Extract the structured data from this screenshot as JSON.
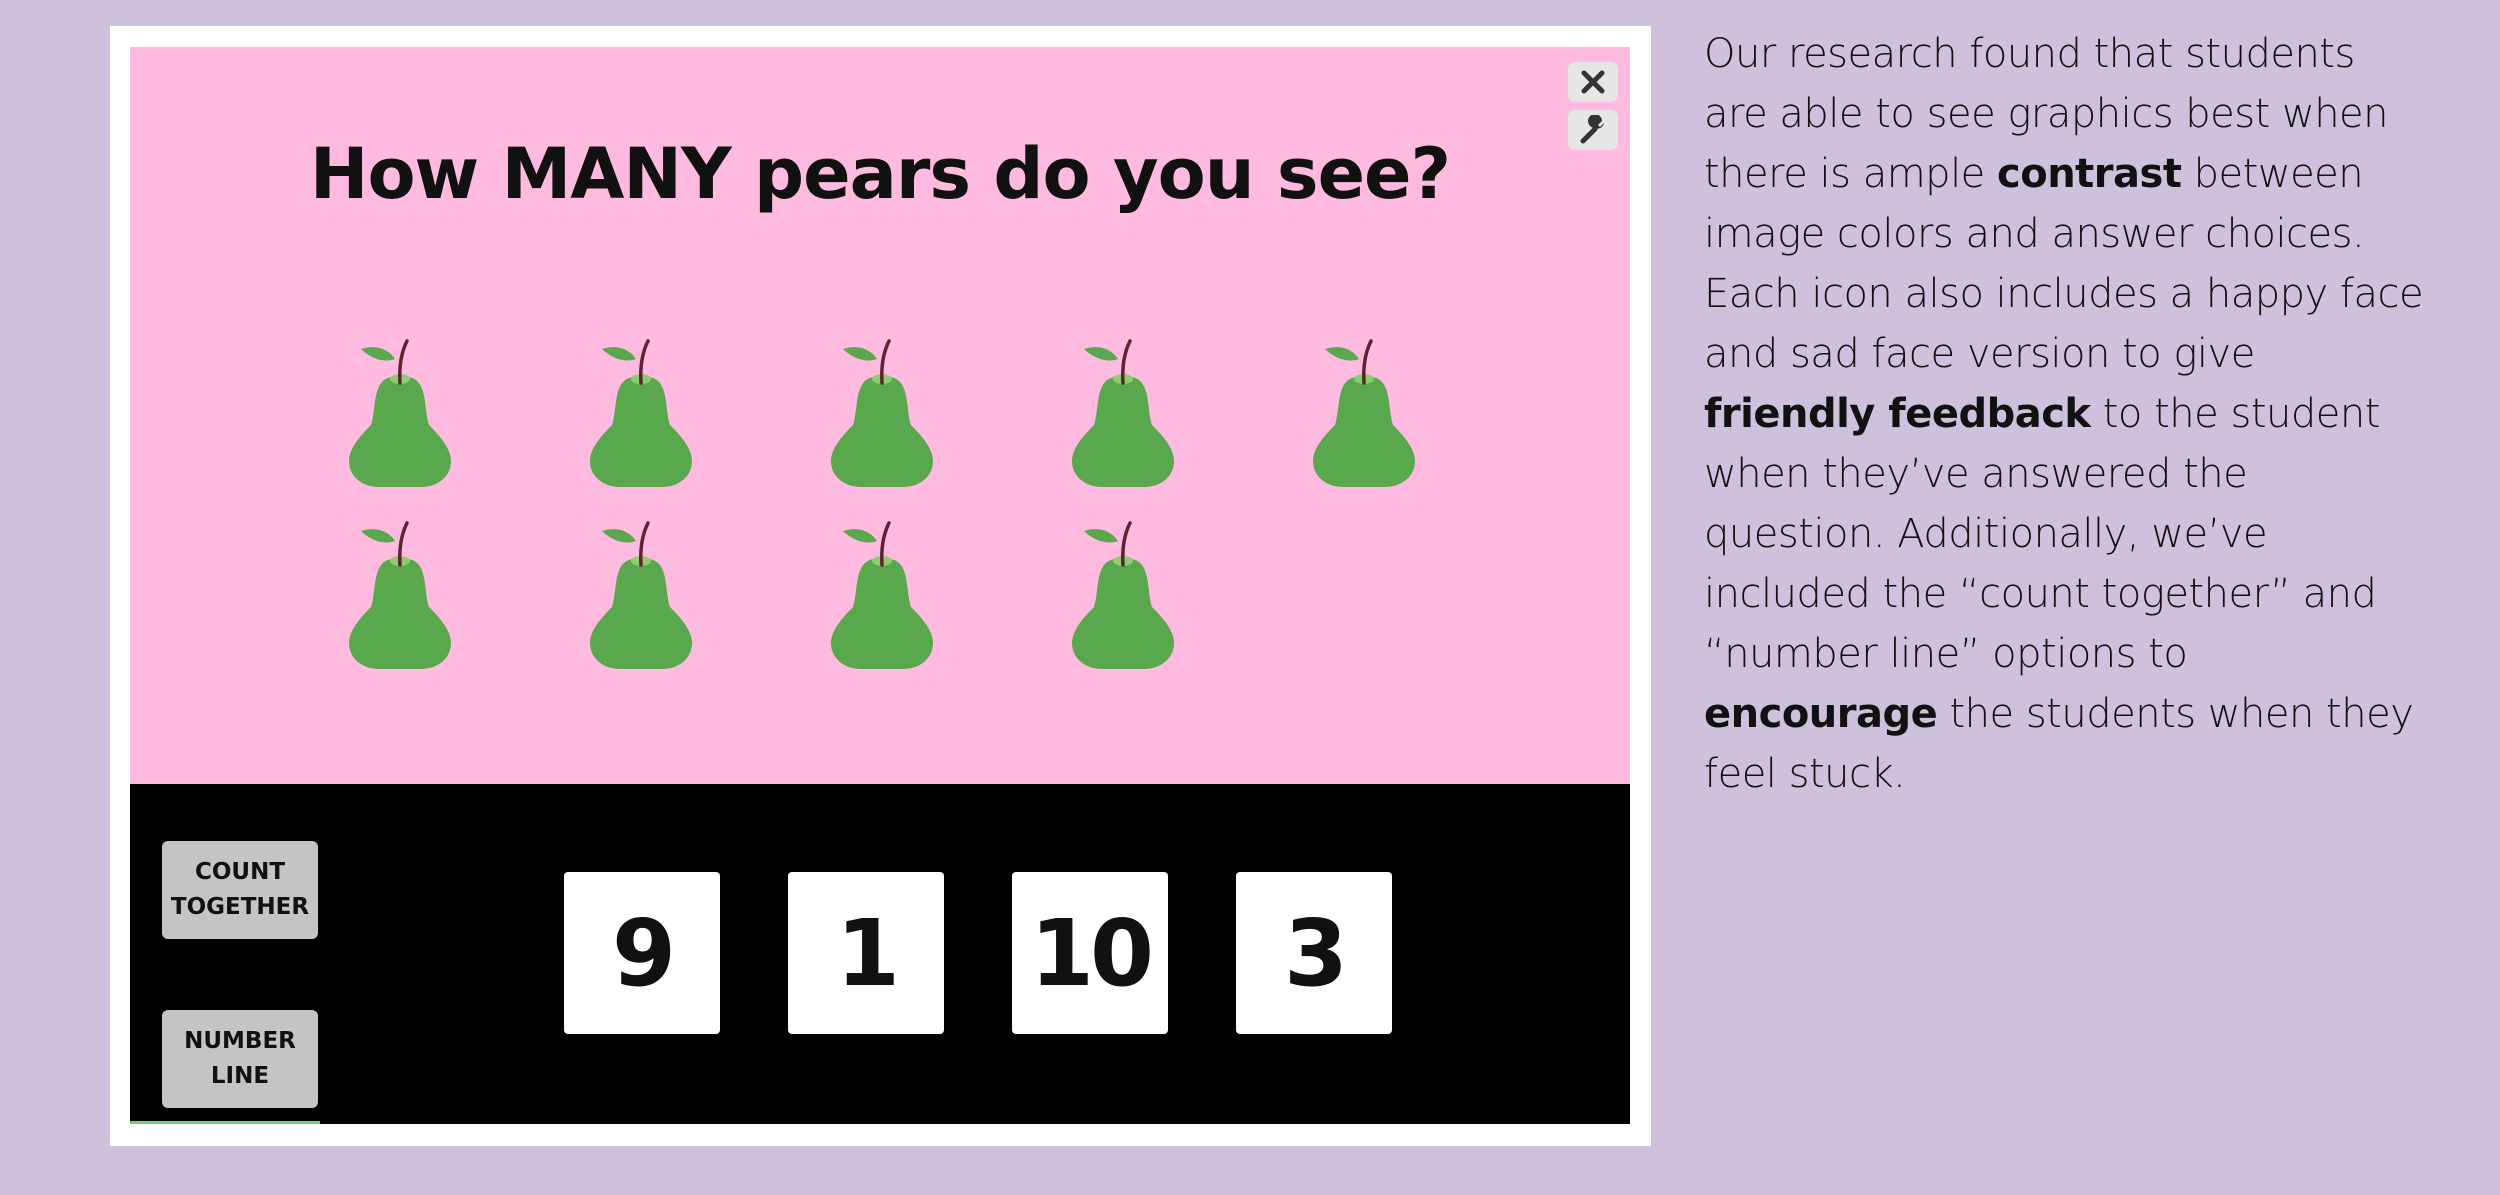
{
  "game": {
    "question": "How MANY pears do you see?",
    "close_icon": "close-icon",
    "tool_icon": "wrench-icon",
    "item_icon": "pear-icon",
    "item_count": 9,
    "colors": {
      "background": "#ffbadf",
      "pear": "#5aa84e",
      "leaf": "#5aa84e",
      "stem": "#5b2430",
      "answer_bar": "#000000"
    }
  },
  "answer_bar": {
    "count_together_line1": "COUNT",
    "count_together_line2": "TOGETHER",
    "number_line_line1": "NUMBER",
    "number_line_line2": "LINE",
    "choices": [
      "9",
      "1",
      "10",
      "3"
    ]
  },
  "description": {
    "part1": "Our research found that students are able to see graphics best when there is ample ",
    "bold1": "contrast",
    "part2": " between image colors and answer choices. Each icon also includes a happy face and sad face version to give ",
    "bold2": "friendly feedback",
    "part3": " to the student when they’ve answered the question. Additionally, we’ve included the “count together” and “number line” options to ",
    "bold3": "encourage",
    "part4": " the students when they feel stuck."
  }
}
